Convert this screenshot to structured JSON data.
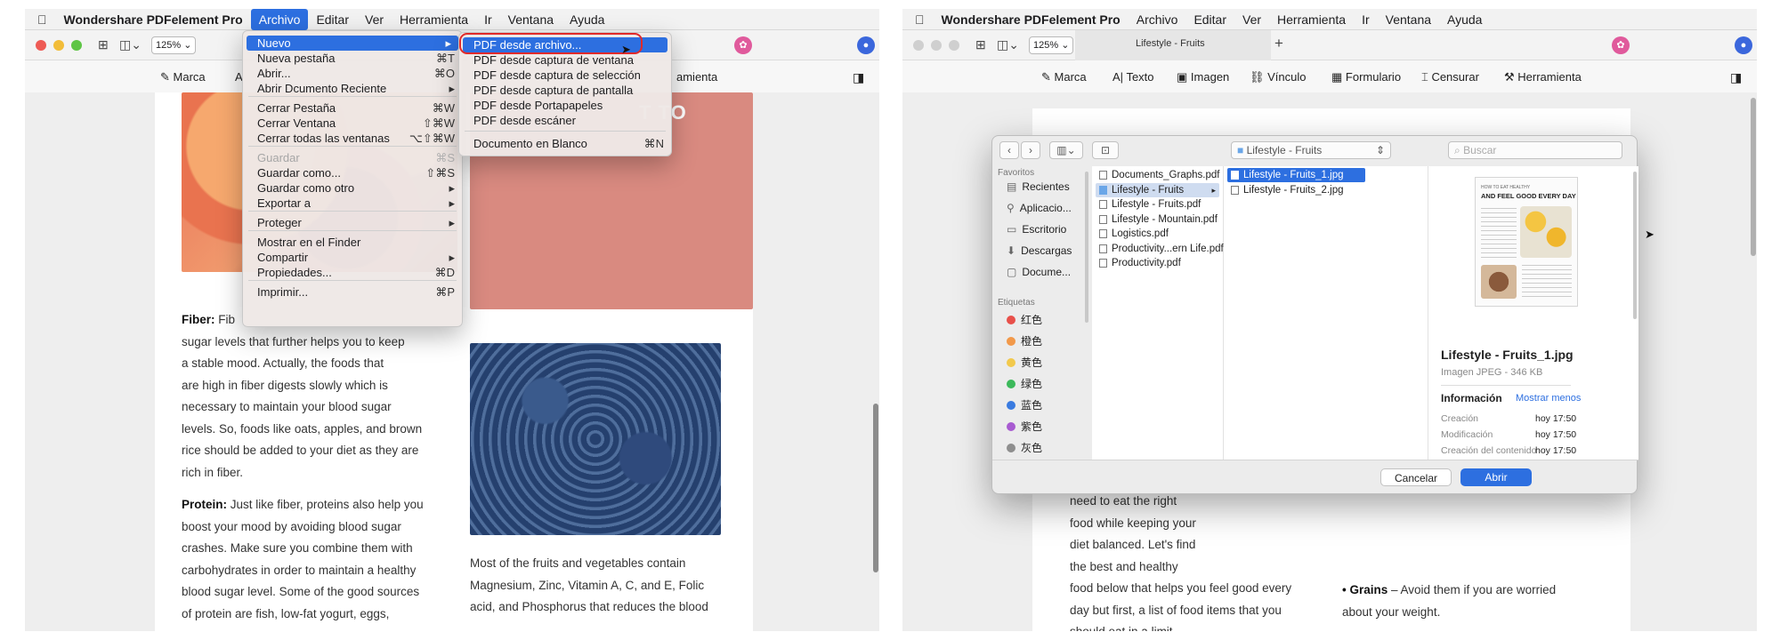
{
  "left": {
    "menubar": {
      "items": [
        "Wondershare PDFelement Pro",
        "Archivo",
        "Editar",
        "Ver",
        "Herramienta",
        "Ir",
        "Ventana",
        "Ayuda"
      ]
    },
    "toolbar": {
      "zoom": "125%"
    },
    "tools": [
      "Marca",
      "A",
      "amienta"
    ],
    "document": {
      "heading_fragment": "T TO",
      "col1": [
        {
          "lead": "Fiber:",
          "text": "Fib"
        },
        "sugar levels that further helps you to keep",
        "a stable mood. Actually, the foods that",
        "are high in fiber digests slowly which is",
        "necessary to maintain your blood sugar",
        "levels. So, foods like oats, apples, and brown",
        "rice should be added to your diet as they are",
        "rich in fiber.",
        {
          "lead": "Protein:",
          "text": " Just like fiber, proteins also help you"
        },
        "boost your mood by avoiding blood sugar",
        "crashes. Make sure you combine them with",
        "carbohydrates in order to maintain a healthy",
        "blood sugar level. Some of the good sources",
        "of protein are fish, low-fat yogurt, eggs,"
      ],
      "col2": [
        "Most of the fruits and vegetables contain",
        "Magnesium, Zinc, Vitamin A, C, and E, Folic",
        "acid, and Phosphorus that reduces the blood"
      ]
    },
    "archivo_menu": [
      {
        "label": "Nuevo",
        "key": "▸",
        "state": "highlight"
      },
      {
        "label": "Nueva pestaña",
        "key": "⌘T"
      },
      {
        "label": "Abrir...",
        "key": "⌘O"
      },
      {
        "label": "Abrir Dcumento Reciente",
        "key": "▸"
      },
      {
        "label": "Cerrar Pestaña",
        "key": "⌘W"
      },
      {
        "label": "Cerrar Ventana",
        "key": "⇧⌘W"
      },
      {
        "label": "Cerrar todas las ventanas",
        "key": "⌥⇧⌘W"
      },
      {
        "label": "Guardar",
        "key": "⌘S",
        "state": "disabled"
      },
      {
        "label": "Guardar como...",
        "key": "⇧⌘S"
      },
      {
        "label": "Guardar como otro",
        "key": "▸"
      },
      {
        "label": "Exportar a",
        "key": "▸"
      },
      {
        "label": "Proteger",
        "key": "▸"
      },
      {
        "label": "Mostrar en el Finder",
        "key": ""
      },
      {
        "label": "Compartir",
        "key": "▸"
      },
      {
        "label": "Propiedades...",
        "key": "⌘D"
      },
      {
        "label": "Imprimir...",
        "key": "⌘P"
      }
    ],
    "nuevo_submenu": [
      {
        "label": "PDF desde archivo...",
        "key": "",
        "state": "highlight"
      },
      {
        "label": "PDF desde captura de ventana",
        "key": ""
      },
      {
        "label": "PDF desde captura de selección",
        "key": ""
      },
      {
        "label": "PDF desde captura de pantalla",
        "key": ""
      },
      {
        "label": "PDF desde Portapapeles",
        "key": ""
      },
      {
        "label": "PDF desde escáner",
        "key": ""
      },
      {
        "label": "Documento en Blanco",
        "key": "⌘N"
      }
    ]
  },
  "right": {
    "menubar": {
      "items": [
        "Wondershare PDFelement Pro",
        "Archivo",
        "Editar",
        "Ver",
        "Herramienta",
        "Ir",
        "Ventana",
        "Ayuda"
      ]
    },
    "toolbar": {
      "zoom": "125%",
      "tab_title": "Lifestyle - Fruits",
      "new_tab": "+"
    },
    "tools": [
      "Marca",
      "Texto",
      "Imagen",
      "Vínculo",
      "Formulario",
      "Censurar",
      "Herramienta"
    ],
    "document": {
      "col1": [
        "need to eat the right",
        "food while keeping your",
        "diet balanced. Let's find",
        "the best and healthy",
        "food below that helps you feel good every",
        "day but first, a list of food items that you",
        "should eat in a limit"
      ],
      "col2": [
        {
          "lead": "• Grains",
          "text": " – Avoid them if you are worried"
        },
        "about your weight."
      ]
    },
    "dialog": {
      "location": "Lifestyle - Fruits",
      "search_placeholder": "Buscar",
      "favorites_header": "Favoritos",
      "favorites": [
        "Recientes",
        "Aplicacio...",
        "Escritorio",
        "Descargas",
        "Docume..."
      ],
      "tags_header": "Etiquetas",
      "tags": [
        {
          "label": "红色",
          "color": "#e8504a"
        },
        {
          "label": "橙色",
          "color": "#f2994a"
        },
        {
          "label": "黄色",
          "color": "#f2c94c"
        },
        {
          "label": "绿色",
          "color": "#3cb95b"
        },
        {
          "label": "蓝色",
          "color": "#3a7be0"
        },
        {
          "label": "紫色",
          "color": "#a85bd1"
        },
        {
          "label": "灰色",
          "color": "#8e8e8e"
        }
      ],
      "column1": [
        "Documents_Graphs.pdf",
        "Lifestyle - Fruits",
        "Lifestyle - Fruits.pdf",
        "Lifestyle - Mountain.pdf",
        "Logistics.pdf",
        "Productivity...ern Life.pdf",
        "Productivity.pdf"
      ],
      "column2": [
        "Lifestyle - Fruits_1.jpg",
        "Lifestyle - Fruits_2.jpg"
      ],
      "preview": {
        "thumb_heading_small": "HOW TO EAT HEALTHY",
        "thumb_heading": "AND FEEL GOOD EVERY DAY",
        "filename": "Lifestyle - Fruits_1.jpg",
        "kind": "Imagen JPEG - 346 KB",
        "info_label": "Información",
        "show_less": "Mostrar menos",
        "rows": [
          {
            "label": "Creación",
            "value": "hoy 17:50"
          },
          {
            "label": "Modificación",
            "value": "hoy 17:50"
          },
          {
            "label": "Creación del contenido",
            "value": "hoy 17:50"
          }
        ]
      },
      "cancel": "Cancelar",
      "open": "Abrir"
    }
  },
  "colors": {
    "accent": "#2d6fe0",
    "highlight_ring": "#e12a2a",
    "salmon_panel": "#d98a80"
  }
}
